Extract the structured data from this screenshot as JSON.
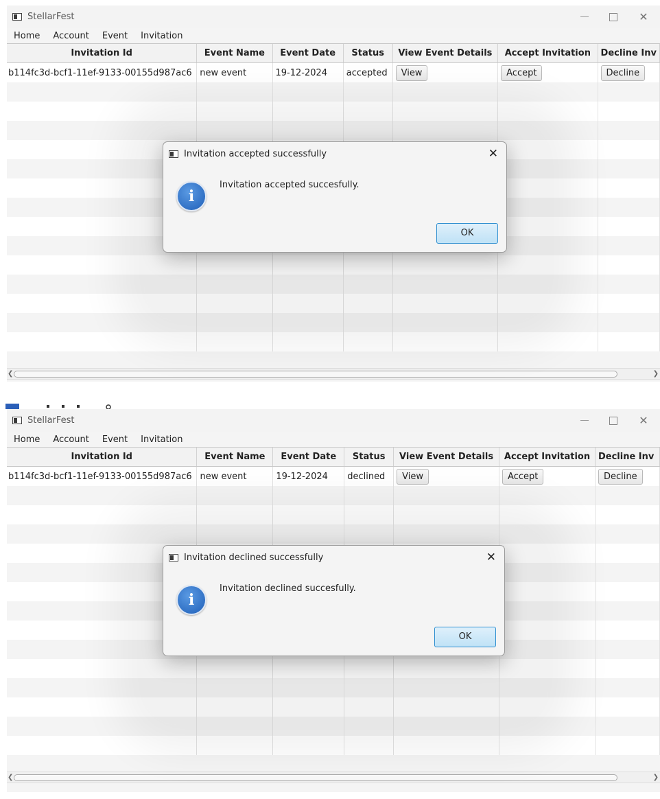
{
  "screens": [
    {
      "window": {
        "title": "StellarFest",
        "menu": [
          "Home",
          "Account",
          "Event",
          "Invitation"
        ]
      },
      "table": {
        "columns": [
          "Invitation Id",
          "Event Name",
          "Event Date",
          "Status",
          "View Event Details",
          "Accept Invitation",
          "Decline Inv"
        ],
        "rows": [
          {
            "invitation_id": "b114fc3d-bcf1-11ef-9133-00155d987ac6",
            "event_name": "new event",
            "event_date": "19-12-2024",
            "status": "accepted",
            "view_label": "View",
            "accept_label": "Accept",
            "decline_label": "Decline"
          }
        ]
      },
      "dialog": {
        "title": "Invitation accepted successfully",
        "message": "Invitation accepted succesfully.",
        "ok_label": "OK",
        "close": "✕"
      }
    },
    {
      "window": {
        "title": "StellarFest",
        "menu": [
          "Home",
          "Account",
          "Event",
          "Invitation"
        ]
      },
      "table": {
        "columns": [
          "Invitation Id",
          "Event Name",
          "Event Date",
          "Status",
          "View Event Details",
          "Accept Invitation",
          "Decline Inv"
        ],
        "rows": [
          {
            "invitation_id": "b114fc3d-bcf1-11ef-9133-00155d987ac6",
            "event_name": "new event",
            "event_date": "19-12-2024",
            "status": "declined",
            "view_label": "View",
            "accept_label": "Accept",
            "decline_label": "Decline"
          }
        ]
      },
      "dialog": {
        "title": "Invitation declined successfully",
        "message": "Invitation declined succesfully.",
        "ok_label": "OK",
        "close": "✕"
      }
    }
  ],
  "icons": {
    "app": "stellarfest-window-icon",
    "info": "info-icon",
    "info_glyph": "i",
    "close": "close-icon",
    "minimize": "minimize-icon",
    "maximize": "maximize-icon"
  },
  "colors": {
    "ok_button_border": "#2f8fd0",
    "info_icon": "#1f5fb8"
  }
}
